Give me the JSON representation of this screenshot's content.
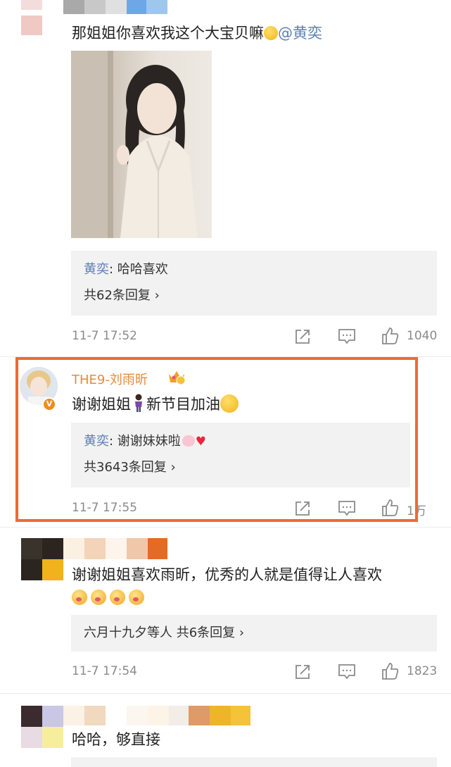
{
  "comments": [
    {
      "text": "那姐姐你喜欢我这个大宝贝嘛",
      "mention": "@黄奕",
      "reply_preview": {
        "author": "黄奕",
        "text": ": 哈哈喜欢"
      },
      "reply_count": "共62条回复 ›",
      "time": "11-7 17:52",
      "likes": "1040"
    },
    {
      "author": "THE9-刘雨昕",
      "text_before": "谢谢姐姐",
      "text_after": "新节目加油",
      "verified_badge": "V",
      "reply_preview": {
        "author": "黄奕",
        "text": ": 谢谢妹妹啦"
      },
      "reply_count": "共3643条回复 ›",
      "time": "11-7 17:55",
      "likes": "1万"
    },
    {
      "text": "谢谢姐姐喜欢雨昕，优秀的人就是值得让人喜欢",
      "reply_users": "六月十九夕等人",
      "reply_count": "共6条回复 ›",
      "time": "11-7 17:54",
      "likes": "1823"
    },
    {
      "text": "哈哈，够直接"
    }
  ],
  "colors": {
    "highlight_border": "#ef6b2f",
    "link_blue": "#5b7fb5",
    "author_orange": "#e58a3c",
    "meta_gray": "#8a8a8a",
    "reply_bg": "#f2f2f2"
  },
  "icons": {
    "share": "share-icon",
    "comment": "comment-icon",
    "like": "thumbs-up-icon",
    "crown": "crown-badge-icon"
  }
}
